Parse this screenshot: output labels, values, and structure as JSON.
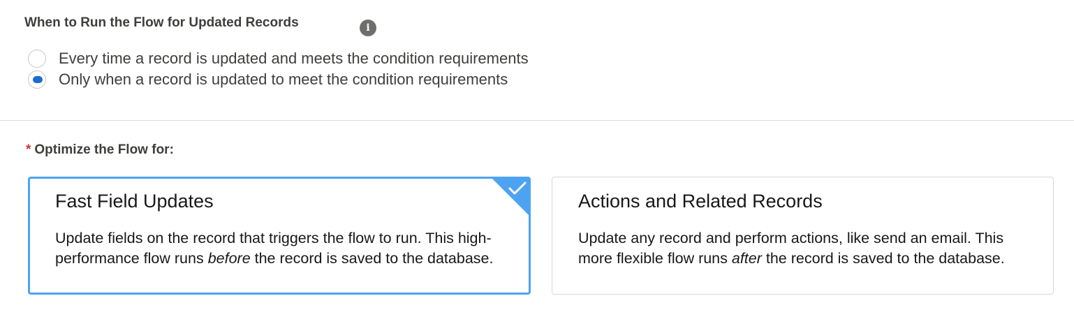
{
  "run_section": {
    "title": "When to Run the Flow for Updated Records",
    "info_icon": "info-icon",
    "options": [
      {
        "label": "Every time a record is updated and meets the condition requirements",
        "selected": false
      },
      {
        "label": "Only when a record is updated to meet the condition requirements",
        "selected": true
      }
    ]
  },
  "optimize_section": {
    "required_marker": "*",
    "label": "Optimize the Flow for:",
    "cards": [
      {
        "title": "Fast Field Updates",
        "desc_before": "Update fields on the record that triggers the flow to run. This high-performance flow runs ",
        "desc_emphasis": "before",
        "desc_after": " the record is saved to the database.",
        "selected": true,
        "selected_icon": "checkmark-icon"
      },
      {
        "title": "Actions and Related Records",
        "desc_before": "Update any record and perform actions, like send an email. This more flexible flow runs ",
        "desc_emphasis": "after",
        "desc_after": " the record is saved to the database.",
        "selected": false
      }
    ]
  },
  "colors": {
    "accent": "#1b6bd1",
    "selected_border": "#4da3f2",
    "required": "#c23934"
  }
}
